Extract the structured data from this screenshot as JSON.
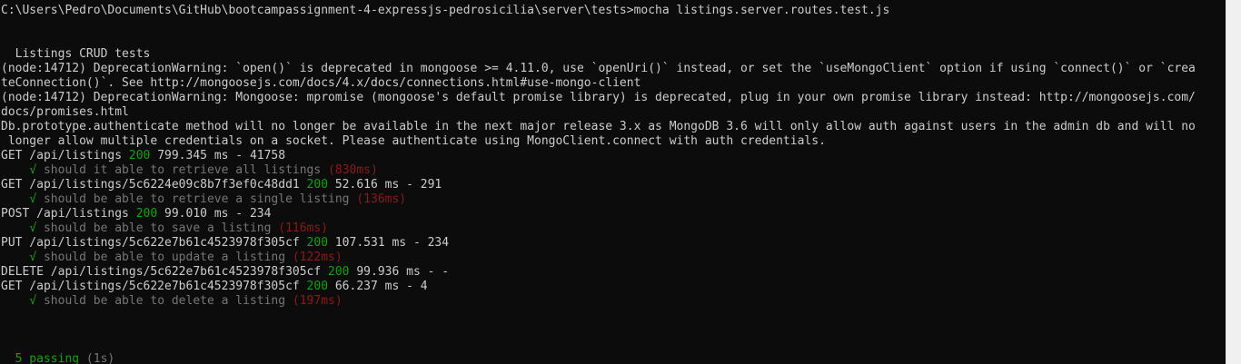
{
  "colors": {
    "background": "#0c0c0c",
    "text": "#cccccc",
    "status_green": "#13a10e",
    "duration_red": "#8b1a1a",
    "scrollbar": "#f0f0f0"
  },
  "prompt": "C:\\Users\\Pedro\\Documents\\GitHub\\bootcampassignment-4-expressjs-pedrosicilia\\server\\tests>mocha listings.server.routes.test.js",
  "suite_title": "  Listings CRUD tests",
  "warnings": [
    "(node:14712) DeprecationWarning: `open()` is deprecated in mongoose >= 4.11.0, use `openUri()` instead, or set the `useMongoClient` option if using `connect()` or `crea",
    "teConnection()`. See http://mongoosejs.com/docs/4.x/docs/connections.html#use-mongo-client",
    "(node:14712) DeprecationWarning: Mongoose: mpromise (mongoose's default promise library) is deprecated, plug in your own promise library instead: http://mongoosejs.com/",
    "docs/promises.html",
    "Db.prototype.authenticate method will no longer be available in the next major release 3.x as MongoDB 3.6 will only allow auth against users in the admin db and will no",
    " longer allow multiple credentials on a socket. Please authenticate using MongoClient.connect with auth credentials."
  ],
  "requests": [
    {
      "method_path": "GET /api/listings ",
      "status": "200",
      "rest": " 799.345 ms - 41758"
    },
    {
      "method_path": "GET /api/listings/5c6224e09c8b7f3ef0c48dd1 ",
      "status": "200",
      "rest": " 52.616 ms - 291"
    },
    {
      "method_path": "POST /api/listings ",
      "status": "200",
      "rest": " 99.010 ms - 234"
    },
    {
      "method_path": "PUT /api/listings/5c622e7b61c4523978f305cf ",
      "status": "200",
      "rest": " 107.531 ms - 234"
    },
    {
      "method_path": "DELETE /api/listings/5c622e7b61c4523978f305cf ",
      "status": "200",
      "rest": " 99.936 ms - -"
    },
    {
      "method_path": "GET /api/listings/5c622e7b61c4523978f305cf ",
      "status": "200",
      "rest": " 66.237 ms - 4"
    }
  ],
  "tests": [
    {
      "check": "√",
      "text": " should it able to retrieve all listings ",
      "duration": "(830ms)"
    },
    {
      "check": "√",
      "text": " should be able to retrieve a single listing ",
      "duration": "(136ms)"
    },
    {
      "check": "√",
      "text": " should be able to save a listing ",
      "duration": "(116ms)"
    },
    {
      "check": "√",
      "text": " should be able to update a listing ",
      "duration": "(122ms)"
    },
    {
      "check": "√",
      "text": " should be able to delete a listing ",
      "duration": "(197ms)"
    }
  ],
  "summary": {
    "passing": "5 passing",
    "time": " (1s)"
  }
}
